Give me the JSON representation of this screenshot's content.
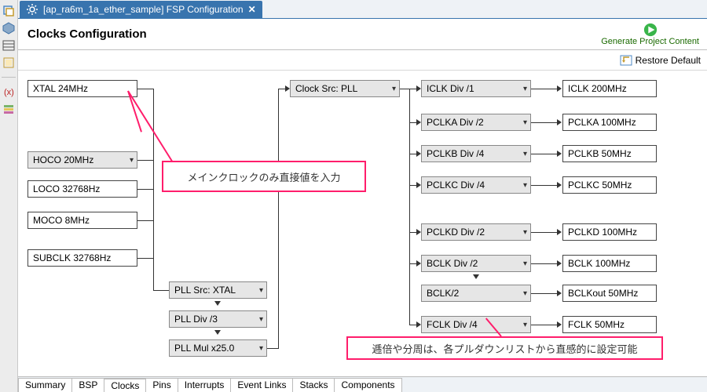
{
  "sidebar_icons": [
    "cube-icon",
    "layout-rows-icon",
    "restore-icon",
    "variable-icon",
    "stack-icon"
  ],
  "editor_tab": {
    "title": "[ap_ra6m_1a_ether_sample] FSP Configuration",
    "close_glyph": "✕"
  },
  "page_title": "Clocks Configuration",
  "generate_button": {
    "label": "Generate Project Content"
  },
  "restore_button": {
    "label": "Restore Default"
  },
  "sources": {
    "xtal": {
      "label": "XTAL 24MHz",
      "is_dropdown": false
    },
    "hoco": {
      "label": "HOCO 20MHz",
      "is_dropdown": true
    },
    "loco": {
      "label": "LOCO 32768Hz",
      "is_dropdown": false
    },
    "moco": {
      "label": "MOCO 8MHz",
      "is_dropdown": false
    },
    "subclk": {
      "label": "SUBCLK 32768Hz",
      "is_dropdown": false
    }
  },
  "pll": {
    "src": "PLL Src: XTAL",
    "div": "PLL Div /3",
    "mul": "PLL Mul x25.0"
  },
  "clock_src": {
    "label": "Clock Src: PLL"
  },
  "dividers": {
    "iclk": "ICLK Div /1",
    "pclka": "PCLKA Div /2",
    "pclkb": "PCLKB Div /4",
    "pclkc": "PCLKC Div /4",
    "pclkd": "PCLKD Div /2",
    "bclk": "BCLK Div /2",
    "bclk2": "BCLK/2",
    "fclk": "FCLK Div /4"
  },
  "outputs": {
    "iclk": "ICLK 200MHz",
    "pclka": "PCLKA 100MHz",
    "pclkb": "PCLKB 50MHz",
    "pclkc": "PCLKC 50MHz",
    "pclkd": "PCLKD 100MHz",
    "bclk": "BCLK 100MHz",
    "bclkout": "BCLKout 50MHz",
    "fclk": "FCLK 50MHz"
  },
  "annotations": {
    "callout1": "メインクロックのみ直接値を入力",
    "callout2": "逓倍や分周は、各プルダウンリストから直感的に設定可能"
  },
  "bottom_tabs": [
    "Summary",
    "BSP",
    "Clocks",
    "Pins",
    "Interrupts",
    "Event Links",
    "Stacks",
    "Components"
  ],
  "colors": {
    "accent_pink": "#ff1d6b",
    "active_tab_blue": "#3874ae"
  }
}
